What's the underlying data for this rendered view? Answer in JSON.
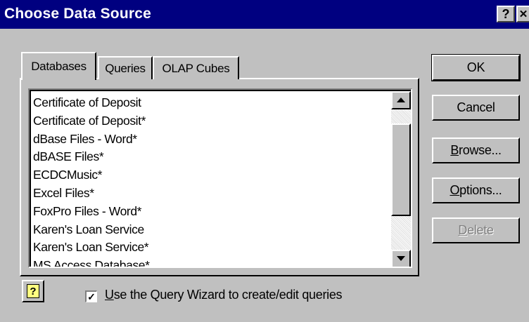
{
  "window": {
    "title": "Choose Data Source",
    "help_button": "?",
    "close_button": "✕"
  },
  "tabs": [
    {
      "label": "Databases",
      "active": true
    },
    {
      "label": "Queries",
      "active": false
    },
    {
      "label": "OLAP Cubes",
      "active": false
    }
  ],
  "data_sources": [
    "Certificate of Deposit",
    "Certificate of Deposit*",
    "dBase Files - Word*",
    "dBASE Files*",
    "ECDCMusic*",
    "Excel Files*",
    "FoxPro Files - Word*",
    "Karen's Loan Service",
    "Karen's Loan Service*",
    "MS Access Database*"
  ],
  "buttons": {
    "ok": "OK",
    "cancel": "Cancel",
    "browse_mnemonic": "B",
    "browse_rest": "rowse...",
    "options_mnemonic": "O",
    "options_rest": "ptions...",
    "delete_mnemonic": "D",
    "delete_rest": "elete"
  },
  "footer": {
    "help_icon": "?",
    "checkbox_checked": true,
    "checkbox_mark": "✓",
    "checkbox_mnemonic": "U",
    "checkbox_rest": "se the Query Wizard to create/edit queries"
  },
  "icons": {
    "scroll_up": "scroll-up-arrow-icon",
    "scroll_down": "scroll-down-arrow-icon"
  }
}
